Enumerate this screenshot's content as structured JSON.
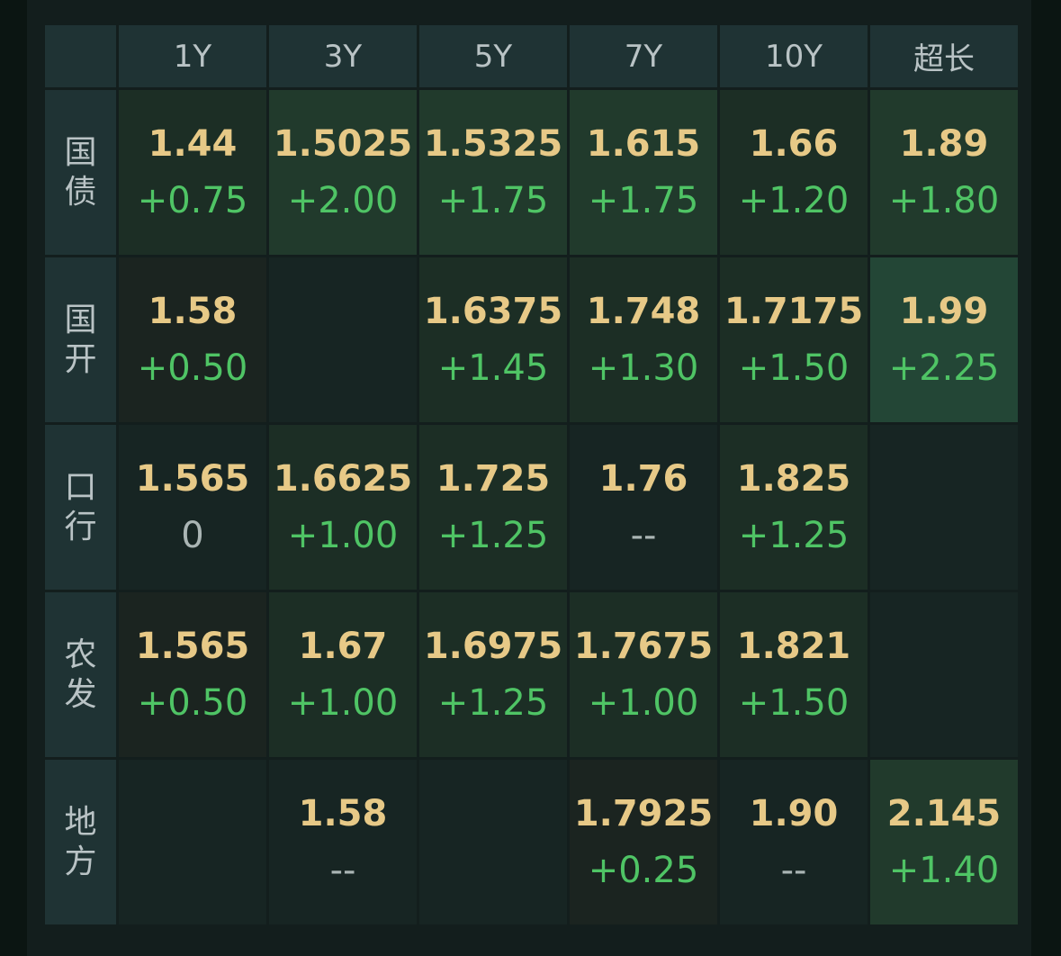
{
  "columns": [
    "1Y",
    "3Y",
    "5Y",
    "7Y",
    "10Y",
    "超长"
  ],
  "rows": [
    {
      "label": [
        "国",
        "债"
      ],
      "cells": [
        {
          "price": "1.44",
          "change": "+0.75"
        },
        {
          "price": "1.5025",
          "change": "+2.00"
        },
        {
          "price": "1.5325",
          "change": "+1.75"
        },
        {
          "price": "1.615",
          "change": "+1.75"
        },
        {
          "price": "1.66",
          "change": "+1.20"
        },
        {
          "price": "1.89",
          "change": "+1.80"
        }
      ]
    },
    {
      "label": [
        "国",
        "开"
      ],
      "cells": [
        {
          "price": "1.58",
          "change": "+0.50"
        },
        {
          "price": "",
          "change": ""
        },
        {
          "price": "1.6375",
          "change": "+1.45"
        },
        {
          "price": "1.748",
          "change": "+1.30"
        },
        {
          "price": "1.7175",
          "change": "+1.50"
        },
        {
          "price": "1.99",
          "change": "+2.25"
        }
      ]
    },
    {
      "label": [
        "口",
        "行"
      ],
      "cells": [
        {
          "price": "1.565",
          "change": "0"
        },
        {
          "price": "1.6625",
          "change": "+1.00"
        },
        {
          "price": "1.725",
          "change": "+1.25"
        },
        {
          "price": "1.76",
          "change": "--"
        },
        {
          "price": "1.825",
          "change": "+1.25"
        },
        {
          "price": "",
          "change": ""
        }
      ]
    },
    {
      "label": [
        "农",
        "发"
      ],
      "cells": [
        {
          "price": "1.565",
          "change": "+0.50"
        },
        {
          "price": "1.67",
          "change": "+1.00"
        },
        {
          "price": "1.6975",
          "change": "+1.25"
        },
        {
          "price": "1.7675",
          "change": "+1.00"
        },
        {
          "price": "1.821",
          "change": "+1.50"
        },
        {
          "price": "",
          "change": ""
        }
      ]
    },
    {
      "label": [
        "地",
        "方"
      ],
      "cells": [
        {
          "price": "",
          "change": ""
        },
        {
          "price": "1.58",
          "change": "--"
        },
        {
          "price": "",
          "change": ""
        },
        {
          "price": "1.7925",
          "change": "+0.25"
        },
        {
          "price": "1.90",
          "change": "--"
        },
        {
          "price": "2.145",
          "change": "+1.40"
        }
      ]
    }
  ],
  "colors": {
    "price": "#e7c987",
    "positive_change": "#4fc465",
    "neutral_change": "#aab5b4",
    "header_bg": "#1f3334"
  }
}
